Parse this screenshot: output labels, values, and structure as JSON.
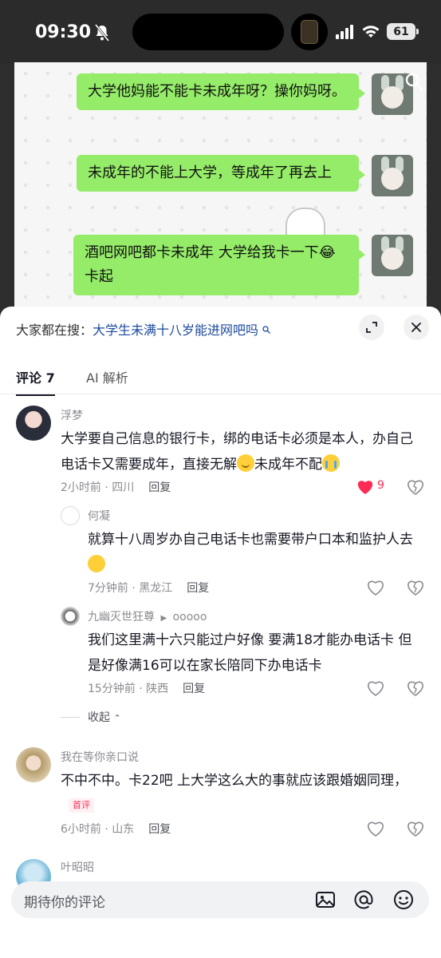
{
  "status_bar": {
    "time": "09:30",
    "battery": "61"
  },
  "chat_screenshot": {
    "messages": [
      {
        "text": "大学他妈能不能卡未成年呀？操你妈呀。"
      },
      {
        "text": "未成年的不能上大学，等成年了再去上"
      },
      {
        "text": "酒吧网吧都卡未成年 大学给我卡一下😂卡起"
      }
    ]
  },
  "search_bar": {
    "prefix": "大家都在搜：",
    "keyword": "大学生未满十八岁能进网吧吗"
  },
  "tabs": [
    {
      "label": "评论 7"
    },
    {
      "label": "AI 解析"
    }
  ],
  "comments": [
    {
      "name": "浮梦",
      "text_part1": "大学要自己信息的银行卡，绑的电话卡必须是本人，办自己电话卡又需要成年，直接无解",
      "text_part2": "未成年不配",
      "meta": "2小时前 · 四川",
      "reply_label": "回复",
      "likes": "9"
    },
    {
      "name": "何凝",
      "text": "就算十八周岁办自己电话卡也需要带户口本和监护人去",
      "meta": "7分钟前 · 黑龙江",
      "reply_label": "回复"
    },
    {
      "name": "九幽灭世狂尊",
      "reply_to": "ooooo",
      "text": "我们这里满十六只能过户好像 要满18才能办电话卡 但是好像满16可以在家长陪同下办电话卡",
      "meta": "15分钟前 · 陕西",
      "reply_label": "回复"
    },
    {
      "collapse_label": "收起"
    },
    {
      "name": "我在等你亲口说",
      "text": "不中不中。卡22吧 上大学这么大的事就应该跟婚姻同理，",
      "tag": "首评",
      "meta": "6小时前 · 山东",
      "reply_label": "回复"
    },
    {
      "name": "叶昭昭"
    }
  ],
  "input_bar": {
    "placeholder": "期待你的评论"
  },
  "colors": {
    "bubble": "#95ec69",
    "like_active": "#fe2c55",
    "keyword": "#1c4a9c"
  }
}
